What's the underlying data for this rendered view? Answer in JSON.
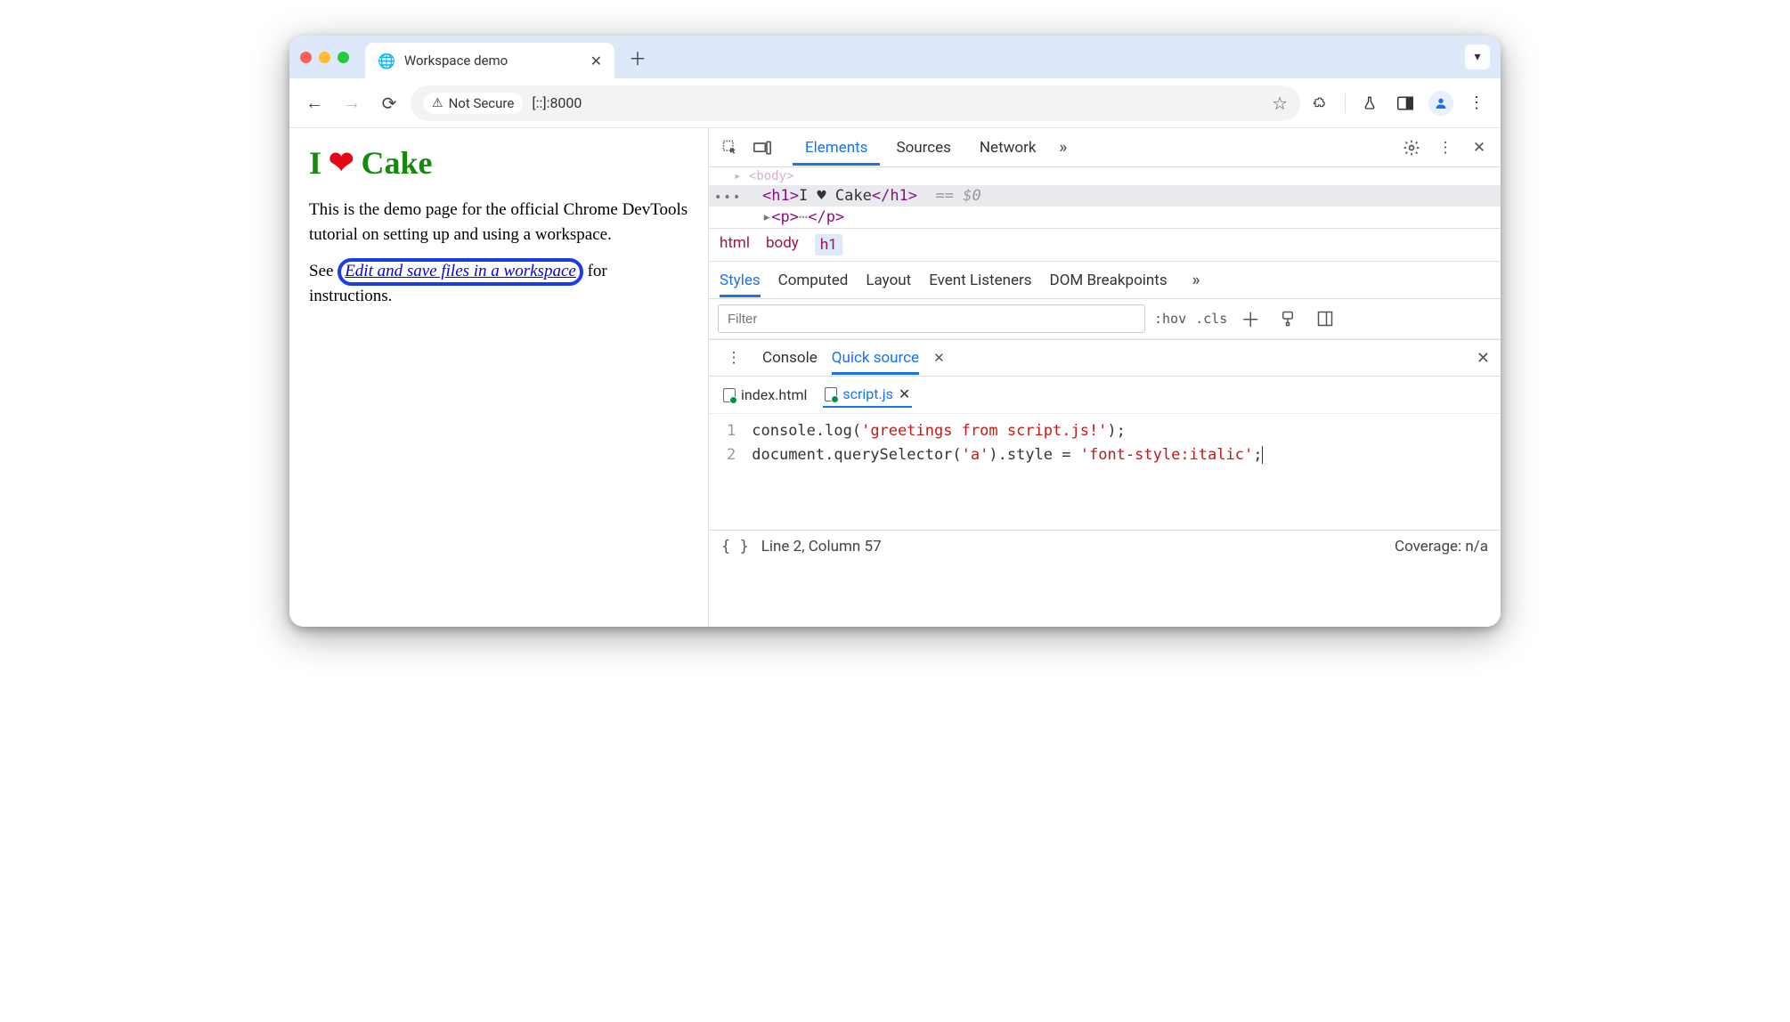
{
  "window": {
    "tab_title": "Workspace demo",
    "chevron_hint": "▾"
  },
  "toolbar": {
    "security_label": "Not Secure",
    "address": "[::]:8000"
  },
  "page": {
    "h1_word1": "I",
    "h1_heart": "❤",
    "h1_word2": "Cake",
    "para1": "This is the demo page for the official Chrome DevTools tutorial on setting up and using a workspace.",
    "para2_pre": "See ",
    "para2_link": "Edit and save files in a workspace",
    "para2_post": " for instructions."
  },
  "devtools": {
    "tabs": {
      "elements": "Elements",
      "sources": "Sources",
      "network": "Network"
    },
    "elements": {
      "line0": "<body>",
      "sel_open": "<h1>",
      "sel_text": "I ♥ Cake",
      "sel_close": "</h1>",
      "sel_marker": "== $0",
      "line2_open": "<p>",
      "line2_close": "</p>"
    },
    "breadcrumbs": [
      "html",
      "body",
      "h1"
    ],
    "styles_tabs": {
      "styles": "Styles",
      "computed": "Computed",
      "layout": "Layout",
      "event": "Event Listeners",
      "dom": "DOM Breakpoints"
    },
    "filter_placeholder": "Filter",
    "hov": ":hov",
    "cls": ".cls",
    "drawer": {
      "console": "Console",
      "quick": "Quick source",
      "files": {
        "index": "index.html",
        "script": "script.js"
      },
      "code": {
        "l1_a": "console.log(",
        "l1_b": "'greetings from script.js!'",
        "l1_c": ");",
        "l2_a": "document.querySelector(",
        "l2_b": "'a'",
        "l2_c": ").style = ",
        "l2_d": "'font-style:italic'",
        "l2_e": ";"
      },
      "gutter": [
        "1",
        "2"
      ]
    },
    "status": {
      "pos": "Line 2, Column 57",
      "coverage": "Coverage: n/a"
    }
  }
}
